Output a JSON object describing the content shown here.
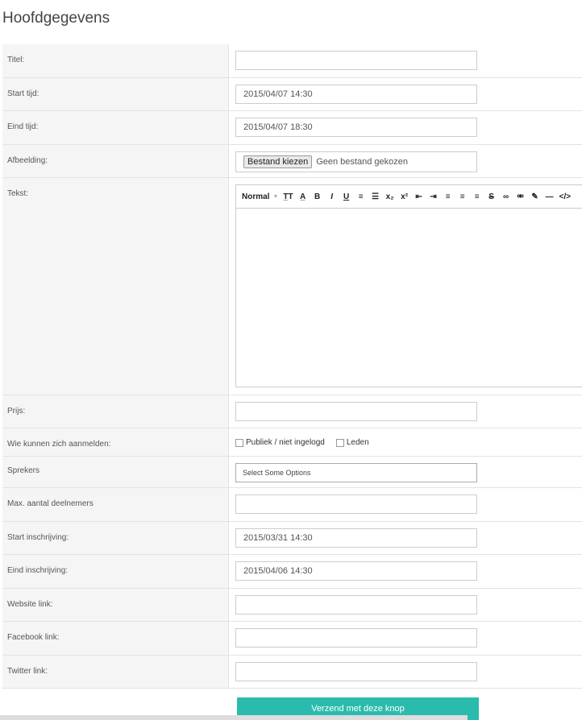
{
  "page": {
    "title": "Hoofdgegevens"
  },
  "fields": [
    {
      "label": "Titel:",
      "value": ""
    },
    {
      "label": "Start tijd:",
      "value": "2015/04/07 14:30"
    },
    {
      "label": "Eind tijd:",
      "value": "2015/04/07 18:30"
    },
    {
      "label": "Afbeelding:",
      "file_button": "Bestand kiezen",
      "file_status": "Geen bestand gekozen"
    },
    {
      "label": "Tekst:"
    },
    {
      "label": "Prijs:",
      "value": ""
    },
    {
      "label": "Wie kunnen zich aanmelden:",
      "options": [
        "Publiek / niet ingelogd",
        "Leden"
      ]
    },
    {
      "label": "Sprekers",
      "placeholder": "Select Some Options"
    },
    {
      "label": "Max. aantal deelnemers",
      "value": ""
    },
    {
      "label": "Start inschrijving:",
      "value": "2015/03/31 14:30"
    },
    {
      "label": "Eind inschrijving:",
      "value": "2015/04/06 14:30"
    },
    {
      "label": "Website link:",
      "value": ""
    },
    {
      "label": "Facebook link:",
      "value": ""
    },
    {
      "label": "Twitter link:",
      "value": ""
    }
  ],
  "editor": {
    "format": "Normal",
    "toolbar": [
      "T̲T",
      "A̲",
      "B",
      "I",
      "U",
      "≡",
      "☰",
      "x₂",
      "x²",
      "⇤",
      "⇥",
      "≡",
      "≡",
      "≡",
      "S",
      "∞",
      "⚮",
      "✎",
      "—",
      "</>"
    ]
  },
  "submit": {
    "label": "Verzend met deze knop"
  },
  "colors": {
    "accent": "#2bbbad"
  }
}
